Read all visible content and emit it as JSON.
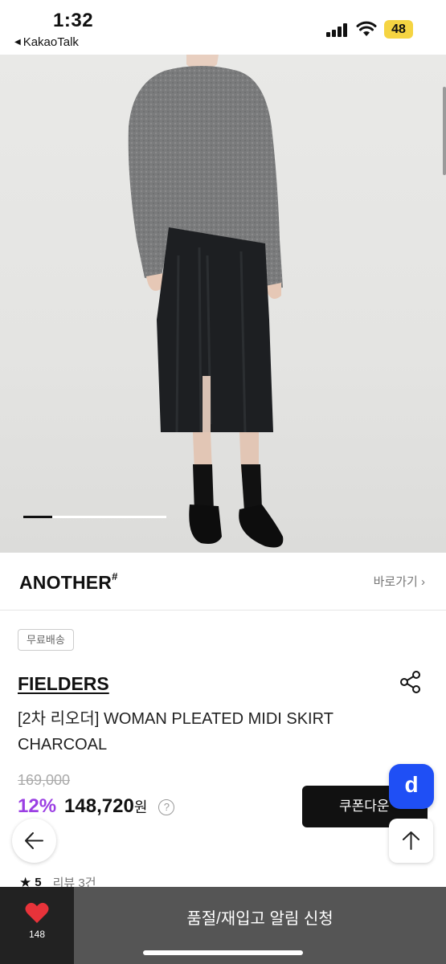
{
  "status_bar": {
    "time": "1:32",
    "back_app": "KakaoTalk",
    "battery": "48"
  },
  "hero": {
    "image_alt": "Model wearing grey knit sweater and charcoal pleated midi skirt",
    "page_progress": 0.2
  },
  "brand": {
    "logo_text": "ANOTHER",
    "logo_mark": "#",
    "goto_label": "바로가기 ›"
  },
  "product": {
    "shipping_badge": "무료배송",
    "seller": "FIELDERS",
    "title": "[2차 리오더] WOMAN PLEATED MIDI SKIRT CHARCOAL",
    "original_price": "169,000",
    "discount": "12%",
    "price": "148,720",
    "currency": "원",
    "help": "?",
    "coupon_label": "쿠폰다운",
    "rating": "5",
    "reviews": "리뷰 3건"
  },
  "floating": {
    "d_label": "d"
  },
  "bottom_bar": {
    "like_count": "148",
    "restock_label": "품절/재입고 알림 신청"
  },
  "colors": {
    "discount": "#9b3fe3",
    "d_button": "#1f4ff5",
    "battery": "#f5d442",
    "heart": "#e8333a"
  }
}
